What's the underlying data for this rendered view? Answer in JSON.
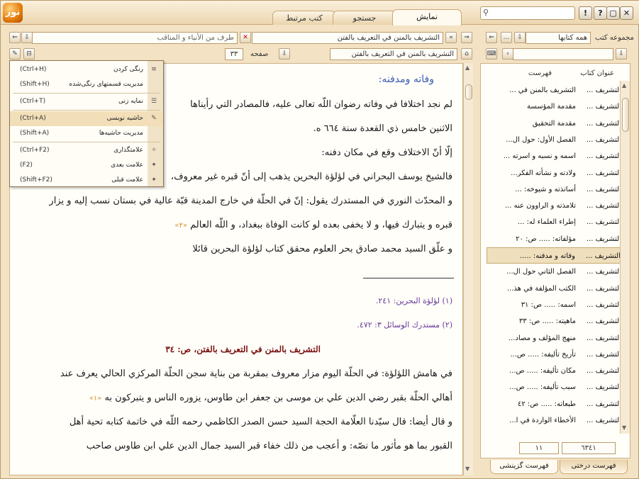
{
  "app": {
    "logo_text": "نور",
    "tabs": [
      "نمایش",
      "جستجو",
      "کتب مرتبط"
    ],
    "window_buttons": [
      "!",
      "?",
      "▢",
      "✕"
    ],
    "search_value": ""
  },
  "nav": {
    "book_field": "التشریف بالمنن في التعریف بالفتن",
    "section_field": "طرف من الأنباء و المناقب",
    "toc_field": "التشریف بالمنن في التعریف بالفتن",
    "page_label": "صفحه",
    "page_value": "۳۳"
  },
  "menu": {
    "items": [
      {
        "label": "رنگی کردن",
        "shortcut": "(Ctrl+H)"
      },
      {
        "label": "مدیریت قسمتهای رنگی‌شده",
        "shortcut": "(Shift+H)"
      },
      {
        "label": "نمایه زنی",
        "shortcut": "(Ctrl+T)"
      },
      {
        "label": "حاشیه نویسی",
        "shortcut": "(Ctrl+A)"
      },
      {
        "label": "مدیریت حاشیه‌ها",
        "shortcut": "(Shift+A)"
      },
      {
        "label": "علامتگذاری",
        "shortcut": "(Ctrl+F2)"
      },
      {
        "label": "علامت بعدی",
        "shortcut": "(F2)"
      },
      {
        "label": "علامت قبلی",
        "shortcut": "(Shift+F2)"
      }
    ]
  },
  "document": {
    "heading": "وفاته ومدفنه:",
    "lines": [
      "لم نجد اختلافا في وفاته رضوان اللّه تعالى عليه، فالمصادر التي رأيناها",
      "الاثنين خامس ذي القعدة سنة ٦٦٤ ه.",
      "إلّا أنّ الاختلاف وقع في مكان دفنه:",
      "فالشيخ يوسف البحراني في لؤلؤة البحرين يذهب إلى أنّ قبره غير معروف،",
      "و المحدّث النوري في المستدرك يقول: إنّ في الحلّة في خارج المدينة قبّة عالية في بستان نسب إليه و يزار",
      "قبره و يتبارك فيها، و لا يخفى بعده لو كانت الوفاة ببغداد، و اللّه العالم",
      "و علّق السيد محمد صادق بحر العلوم محقق كتاب لؤلؤة البحرين قائلا"
    ],
    "ref_marker": "«٢»",
    "footnotes": [
      "(١) لؤلؤة البحرين: ٢٤١.",
      "(٢) مستدرك الوسائل ٣: ٤٧٢."
    ],
    "page_title": "التشريف بالمنن في التعريف بالفتن، ص: ٣٤",
    "lines2": [
      "في هامش اللؤلؤة: في الحلّة اليوم مزار معروف بمقربة من بناية سجن الحلّة المركزي الحالي يعرف عند",
      "أهالي الحلّة بقبر رضي الدين علي بن موسى بن جعفر ابن طاوس، يزوره الناس و يتبركون به",
      "و قال أيضا: قال سيّدنا العلّامة الحجة السيد حسن الصدر الكاظمي رحمه اللّه في خاتمة كتابه تحية أهل",
      "القبور بما هو مأثور ما نصّه: و أعجب من ذلك خفاء قبر السيد جمال الدين علي ابن طاوس صاحب"
    ],
    "ref_marker2": "«١»"
  },
  "sidebar": {
    "collection_label": "مجموعه کتب",
    "collection_value": "همه کتابها",
    "col_book": "عنوان کتاب",
    "col_toc": "فهرست",
    "rows": [
      {
        "book": "التشريف ...",
        "toc": "التشريف بالمنن في ..."
      },
      {
        "book": "التشريف ...",
        "toc": "مقدمة المؤسسة"
      },
      {
        "book": "التشريف ...",
        "toc": "مقدمة التحقيق"
      },
      {
        "book": "التشريف ...",
        "toc": "الفصل الأول: حول ال..."
      },
      {
        "book": "التشريف ...",
        "toc": "اسمه و نسبه و اسرته ..."
      },
      {
        "book": "التشريف ...",
        "toc": "ولادته و نشأته الفكر..."
      },
      {
        "book": "التشريف ...",
        "toc": "أساتذته و شيوخه: ..."
      },
      {
        "book": "التشريف ...",
        "toc": "تلامذته و الراوون عنه ..."
      },
      {
        "book": "التشريف ...",
        "toc": "إطراء العلماء له: ..."
      },
      {
        "book": "التشريف ...",
        "toc": "مؤلفاته: ..... ص: ٢٠"
      },
      {
        "book": "التشريف ...",
        "toc": "وفاته و مدفنه: ....."
      },
      {
        "book": "التشريف ...",
        "toc": "الفصل الثاني حول ال..."
      },
      {
        "book": "التشريف ...",
        "toc": "الكتب المؤلفة في هذ..."
      },
      {
        "book": "التشريف ...",
        "toc": "اسمه: ..... ص: ٣١"
      },
      {
        "book": "التشريف ...",
        "toc": "ماهيته: ..... ص: ٣٣"
      },
      {
        "book": "التشريف ...",
        "toc": "منهج المؤلف و مصاد..."
      },
      {
        "book": "التشريف ...",
        "toc": "تأريخ تأليفه: ..... ص..."
      },
      {
        "book": "التشريف ...",
        "toc": "مكان تأليفه: ..... ص..."
      },
      {
        "book": "التشريف ...",
        "toc": "سبب تأليفه: ..... ص..."
      },
      {
        "book": "التشريف ...",
        "toc": "طبعاته: ..... ص: ٤٢"
      },
      {
        "book": "التشريف ...",
        "toc": "الأخطاء الواردة في ا..."
      }
    ],
    "count_left": "١١",
    "count_right": "٦٣٤١",
    "bottom_tabs": [
      "فهرست درختی",
      "فهرست گزینشی"
    ]
  }
}
